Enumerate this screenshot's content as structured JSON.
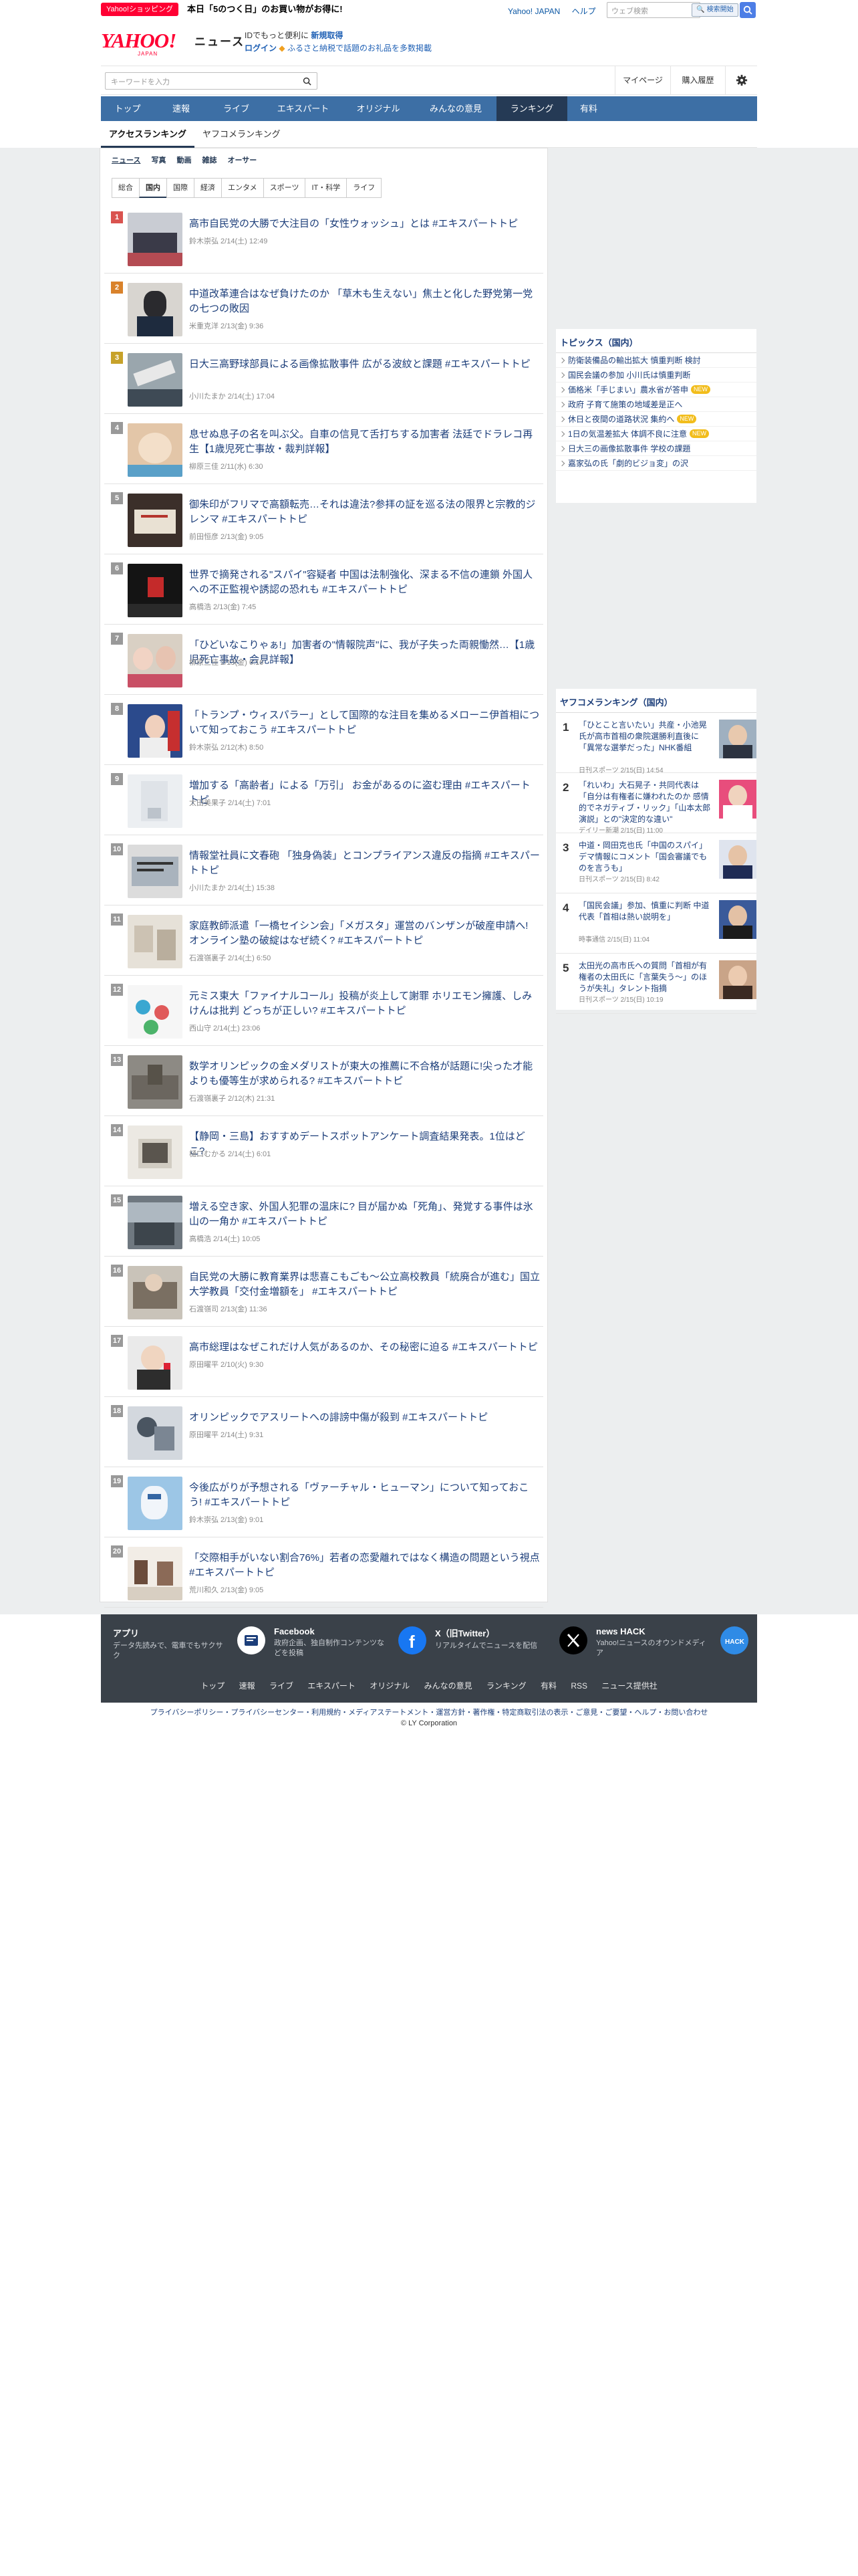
{
  "topbar": {
    "badge": "Yahoo!ショッピング",
    "promo": "本日「5のつく日」のお買い物がお得に!",
    "links": [
      "Yahoo! JAPAN",
      "ヘルプ"
    ],
    "web_search_placeholder": "ウェブ検索",
    "web_search_button": "🔍 検索開始"
  },
  "header": {
    "logo": "YAHOO!",
    "logo_sub": "JAPAN",
    "section": "ニュース",
    "promo_line1_a": "IDでもっと便利に",
    "promo_line1_b": "新規取得",
    "promo_login": "ログイン",
    "promo_furusato": "ふるさと納税で話題のお礼品を多数掲載"
  },
  "search": {
    "placeholder": "キーワードを入力",
    "mypage": "マイページ",
    "history": "購入履歴"
  },
  "gnav": [
    "トップ",
    "速報",
    "ライブ",
    "エキスパート",
    "オリジナル",
    "みんなの意見",
    "ランキング",
    "有料"
  ],
  "gnav_active": "ランキング",
  "rank_tabs": [
    "アクセスランキング",
    "ヤフコメランキング"
  ],
  "categories": [
    "ニュース",
    "写真",
    "動画",
    "雑誌",
    "オーサー"
  ],
  "subcategories": [
    "総合",
    "国内",
    "国際",
    "経済",
    "エンタメ",
    "スポーツ",
    "IT・科学",
    "ライフ"
  ],
  "active_subcategory": "国内",
  "articles": [
    {
      "rank": "1",
      "title": "高市自民党の大勝で大注目の「女性ウォッシュ」とは #エキスパートトピ",
      "meta": "鈴木崇弘 2/14(土) 12:49"
    },
    {
      "rank": "2",
      "title": "中道改革連合はなぜ負けたのか 「草木も生えない」焦土と化した野党第一党の七つの敗因",
      "meta": "米重克洋 2/13(金) 9:36"
    },
    {
      "rank": "3",
      "title": "日大三高野球部員による画像拡散事件 広がる波紋と課題 #エキスパートトピ",
      "meta": "小川たまか 2/14(土) 17:04"
    },
    {
      "rank": "4",
      "title": "息せぬ息子の名を叫ぶ父。自車の信見て舌打ちする加害者 法廷でドラレコ再生【1歳児死亡事故・裁判詳報】",
      "meta": "柳原三佳 2/11(水) 6:30"
    },
    {
      "rank": "5",
      "title": "御朱印がフリマで高額転売…それは違法?参拝の証を巡る法の限界と宗教的ジレンマ #エキスパートトピ",
      "meta": "前田恒彦 2/13(金) 9:05"
    },
    {
      "rank": "6",
      "title": "世界で摘発される\"スパイ\"容疑者 中国は法制強化、深まる不信の連鎖 外国人への不正監視や誘認の恐れも #エキスパートトピ",
      "meta": "高橋浩 2/13(金) 7:45"
    },
    {
      "rank": "7",
      "title": "「ひどいなこりゃぁ!」加害者の\"情報院声\"に、我が子失った両親慟然…【1歳児死亡事故・会見詳報】",
      "meta": "柳原三佳 2/13(金) 6:16"
    },
    {
      "rank": "8",
      "title": "「トランプ・ウィスパラー」として国際的な注目を集めるメローニ伊首相について知っておこう #エキスパートトピ",
      "meta": "鈴木崇弘 2/12(木) 8:50"
    },
    {
      "rank": "9",
      "title": "増加する「高齢者」による「万引」 お金があるのに盗む理由 #エキスパートトピ",
      "meta": "太田美果子 2/14(土) 7:01"
    },
    {
      "rank": "10",
      "title": "情報堂社員に文春砲 「独身偽装」とコンプライアンス違反の指摘 #エキスパートトピ",
      "meta": "小川たまか 2/14(土) 15:38"
    },
    {
      "rank": "11",
      "title": "家庭教師派遣「一橋セイシン会」「メガスタ」運営のバンザンが破産申請へ! オンライン塾の破綻はなぜ続く? #エキスパートトピ",
      "meta": "石渡嶺裏子 2/14(土) 6:50"
    },
    {
      "rank": "12",
      "title": "元ミス東大「ファイナルコール」投稿が炎上して謝罪 ホリエモン擁護、しみけんは批判 どっちが正しい? #エキスパートトピ",
      "meta": "西山守 2/14(土) 23:06"
    },
    {
      "rank": "13",
      "title": "数学オリンピックの金メダリストが東大の推薦に不合格が話題に!尖った才能よりも優等生が求められる? #エキスパートトピ",
      "meta": "石渡嶺裏子 2/12(木) 21:31"
    },
    {
      "rank": "14",
      "title": "【静岡・三島】おすすめデートスポットアンケート調査結果発表。1位はどこ?",
      "meta": "樋口むかる 2/14(土) 6:01"
    },
    {
      "rank": "15",
      "title": "増える空き家、外国人犯罪の温床に? 目が届かぬ「死角」、発覚する事件は氷山の一角か #エキスパートトピ",
      "meta": "高橋浩 2/14(土) 10:05"
    },
    {
      "rank": "16",
      "title": "自民党の大勝に教育業界は悲喜こもごも〜公立高校教員「統廃合が進む」国立大学教員「交付金増額を」 #エキスパートトピ",
      "meta": "石渡嶺司 2/13(金) 11:36"
    },
    {
      "rank": "17",
      "title": "高市総理はなぜこれだけ人気があるのか、その秘密に迫る #エキスパートトピ",
      "meta": "原田曜平 2/10(火) 9:30"
    },
    {
      "rank": "18",
      "title": "オリンピックでアスリートへの誹謗中傷が殺到 #エキスパートトピ",
      "meta": "原田曜平 2/14(土) 9:31"
    },
    {
      "rank": "19",
      "title": "今後広がりが予想される「ヴァーチャル・ヒューマン」について知っておこう! #エキスパートトピ",
      "meta": "鈴木崇弘 2/13(金) 9:01"
    },
    {
      "rank": "20",
      "title": "「交際相手がいない割合76%」若者の恋愛離れではなく構造の問題という視点 #エキスパートトピ",
      "meta": "荒川和久 2/13(金) 9:05"
    }
  ],
  "topics": {
    "title": "トピックス（国内）",
    "items": [
      {
        "text": "防衛装備品の輸出拡大 慎重判断 検討",
        "new": ""
      },
      {
        "text": "国民会議の参加 小川氏は慎重判断",
        "new": ""
      },
      {
        "text": "価格米「手じまい」農水省が答申",
        "new": "NEW"
      },
      {
        "text": "政府 子育て施策の地域差是正へ",
        "new": ""
      },
      {
        "text": "休日と夜間の道路状況 集約へ",
        "new": "NEW"
      },
      {
        "text": "1日の気温差拡大 体調不良に注意",
        "new": "NEW"
      },
      {
        "text": "日大三の画像拡散事件 学校の課題",
        "new": ""
      },
      {
        "text": "嘉家弘の氏「劇的ビジョ変」の沢",
        "new": ""
      }
    ]
  },
  "yafuko": {
    "title": "ヤフコメランキング（国内）",
    "items": [
      {
        "rank": "1",
        "title": "「ひとこと言いたい」共産・小池晃氏が高市首相の衆院選勝利直後に「異常な選挙だった」NHK番組",
        "meta": "日刊スポーツ 2/15(日) 14:54"
      },
      {
        "rank": "2",
        "title": "「れいわ」大石晃子・共同代表は「自分は有権者に嫌われたのか 感情的でネガティブ・リック」「山本太郎演説」との\"決定的な違い\"",
        "meta": "デイリー新潮 2/15(日) 11:00"
      },
      {
        "rank": "3",
        "title": "中道・岡田克也氏「中国のスパイ」デマ情報にコメント「国会審議でものを言うも」",
        "meta": "日刊スポーツ 2/15(日) 8:42"
      },
      {
        "rank": "4",
        "title": "「国民会議」参加、慎重に判断 中道代表「首相は熱い説明を」",
        "meta": "時事通信 2/15(日) 11:04"
      },
      {
        "rank": "5",
        "title": "太田光の高市氏への質問「首相が有権者の太田氏に「言葉失う〜」のほうが失礼」タレント指摘",
        "meta": "日刊スポーツ 2/15(日) 10:19"
      }
    ]
  },
  "footer": {
    "cells": [
      {
        "title": "アプリ",
        "desc": "データ先読みで、電車でもサクサク"
      },
      {
        "title": "Facebook",
        "desc": "政府企画、独自制作コンテンツなどを投稿"
      },
      {
        "title": "X（旧Twitter）",
        "desc": "リアルタイムでニュースを配信"
      },
      {
        "title": "news HACK",
        "desc": "Yahoo!ニュースのオウンドメディア"
      }
    ],
    "nav": [
      "トップ",
      "速報",
      "ライブ",
      "エキスパート",
      "オリジナル",
      "みんなの意見",
      "ランキング",
      "有料",
      "RSS",
      "ニュース提供社"
    ],
    "legal": "プライバシーポリシー・プライバシーセンター・利用規約・メディアステートメント・運営方針・著作権・特定商取引法の表示・ご意見・ご要望・ヘルプ・お問い合わせ",
    "copyright": "© LY Corporation"
  },
  "colors": {
    "nav": "#3d6fa5",
    "nav_active": "#253a55",
    "link": "#1c3e7a",
    "brand": "#ff0033"
  }
}
